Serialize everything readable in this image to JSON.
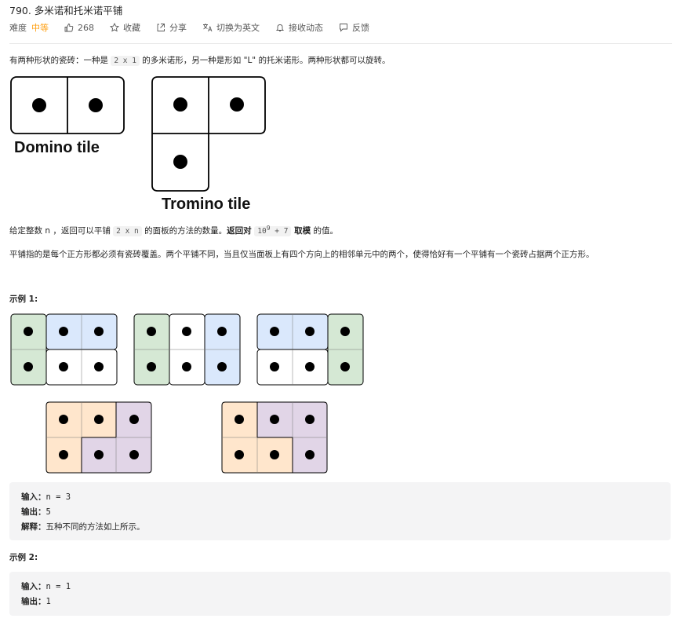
{
  "header": {
    "title": "790. 多米诺和托米诺平铺",
    "difficulty_label": "难度",
    "difficulty_value": "中等",
    "likes": "268",
    "favorite": "收藏",
    "share": "分享",
    "switch_lang": "切换为英文",
    "notify": "接收动态",
    "feedback": "反馈"
  },
  "content": {
    "intro_a": "有两种形状的瓷砖：一种是 ",
    "intro_code": "2 x 1",
    "intro_b": " 的多米诺形，另一种是形如 \"L\" 的托米诺形。两种形状都可以旋转。",
    "domino_caption": "Domino tile",
    "tromino_caption": "Tromino tile",
    "q_a": "给定整数 n ，返回可以平铺 ",
    "q_code": "2 x n",
    "q_b": " 的面板的方法的数量。",
    "q_bold1": "返回对 ",
    "q_mod_base": "10",
    "q_mod_exp": "9",
    "q_mod_rest": " + 7",
    "q_bold2": " 取模",
    "q_c": " 的值。",
    "definition": "平铺指的是每个正方形都必须有瓷砖覆盖。两个平铺不同，当且仅当面板上有四个方向上的相邻单元中的两个，使得恰好有一个平铺有一个瓷砖占据两个正方形。"
  },
  "example1": {
    "title": "示例 1:",
    "input_label": "输入：",
    "input_value": "n = 3",
    "output_label": "输出：",
    "output_value": "5",
    "explain_label": "解释：",
    "explain_value": "五种不同的方法如上所示。"
  },
  "example2": {
    "title": "示例 2:",
    "input_label": "输入：",
    "input_value": "n = 1",
    "output_label": "输出：",
    "output_value": "1"
  },
  "colors": {
    "accent_difficulty": "#ffa116",
    "tile_green": "#d5e8d4",
    "tile_blue": "#dae8fc",
    "tile_orange": "#ffe6cc",
    "tile_purple": "#e1d5e7",
    "tile_white": "#ffffff"
  },
  "icons": [
    "thumb-up-icon",
    "star-icon",
    "share-icon",
    "translate-icon",
    "bell-icon",
    "feedback-icon"
  ]
}
